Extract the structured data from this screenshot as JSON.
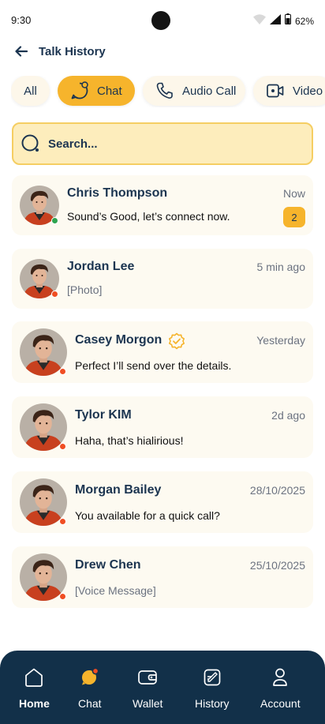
{
  "status_bar": {
    "time": "9:30",
    "battery": "62%"
  },
  "header": {
    "title": "Talk History"
  },
  "tabs": [
    {
      "label": "All",
      "active": false
    },
    {
      "label": "Chat",
      "active": true
    },
    {
      "label": "Audio Call",
      "active": false
    },
    {
      "label": "Video",
      "active": false
    }
  ],
  "search": {
    "placeholder": "Search..."
  },
  "conversations": [
    {
      "name": "Chris Thompson",
      "message": "Sound’s Good, let’s connect now.",
      "time": "Now",
      "unread": "2",
      "status": "online",
      "verified": false
    },
    {
      "name": "Jordan Lee",
      "message": "[Photo]",
      "time": "5 min ago",
      "unread": "",
      "status": "offline",
      "verified": false
    },
    {
      "name": "Casey Morgon",
      "message": "Perfect I’ll send over the details.",
      "time": "Yesterday",
      "unread": "",
      "status": "offline",
      "verified": true
    },
    {
      "name": "Tylor KIM",
      "message": "Haha, that’s hialirious!",
      "time": "2d ago",
      "unread": "",
      "status": "offline",
      "verified": false
    },
    {
      "name": "Morgan Bailey",
      "message": "You available for a quick call?",
      "time": "28/10/2025",
      "unread": "",
      "status": "offline",
      "verified": false
    },
    {
      "name": "Drew Chen",
      "message": "[Voice Message]",
      "time": "25/10/2025",
      "unread": "",
      "status": "offline",
      "verified": false
    }
  ],
  "bottom_nav": [
    {
      "label": "Home",
      "icon": "home-icon",
      "active": true
    },
    {
      "label": "Chat",
      "icon": "chat-icon",
      "active": false
    },
    {
      "label": "Wallet",
      "icon": "wallet-icon",
      "active": false
    },
    {
      "label": "History",
      "icon": "history-icon",
      "active": false
    },
    {
      "label": "Account",
      "icon": "account-icon",
      "active": false
    }
  ],
  "colors": {
    "accent": "#f6b42c",
    "navy": "#123049",
    "online": "#2ea44f",
    "offline": "#f04e23",
    "card": "#fdfaf1"
  }
}
